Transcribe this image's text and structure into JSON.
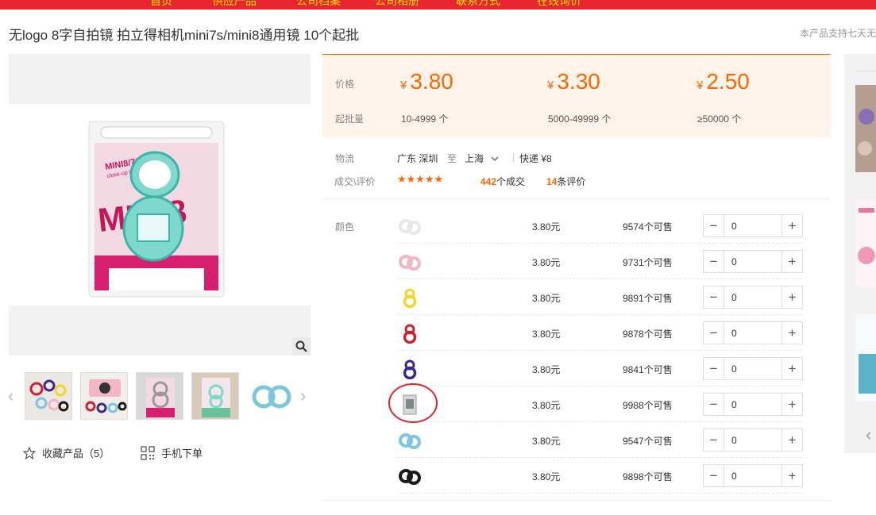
{
  "nav": {
    "items": [
      "首页",
      "供应产品",
      "公司档案",
      "公司相册",
      "联系方式",
      "在线询价"
    ]
  },
  "product": {
    "title": "无logo 8字自拍镜 拍立得相机mini7s/mini8通用镜 10个起批",
    "support_note": "本产品支持七天无"
  },
  "pricing": {
    "price_label": "价格",
    "moq_label": "起批量",
    "currency": "¥",
    "tiers": [
      {
        "price": "3.80",
        "range": "10-4999 个"
      },
      {
        "price": "3.30",
        "range": "5000-49999 个"
      },
      {
        "price": "2.50",
        "range": "≥50000 个"
      }
    ]
  },
  "logistics": {
    "label": "物流",
    "from": "广东 深圳",
    "to_word": "至",
    "to": "上海",
    "shipping": "快递 ¥8"
  },
  "trade": {
    "label": "成交\\评价",
    "stars": "★★★★★",
    "deals_count": "442",
    "deals_suffix": "个成交",
    "reviews_count": "14",
    "reviews_suffix": "条评价"
  },
  "sku": {
    "label": "颜色",
    "rows": [
      {
        "color_name": "white",
        "color": "#e8e8e8",
        "price": "3.80元",
        "stock": "9574个可售",
        "qty": "0"
      },
      {
        "color_name": "pink",
        "color": "#f2b6c4",
        "price": "3.80元",
        "stock": "9731个可售",
        "qty": "0"
      },
      {
        "color_name": "yellow",
        "color": "#f5d52a",
        "price": "3.80元",
        "stock": "9891个可售",
        "qty": "0"
      },
      {
        "color_name": "red",
        "color": "#d0212e",
        "price": "3.80元",
        "stock": "9878个可售",
        "qty": "0"
      },
      {
        "color_name": "purple",
        "color": "#3a2a8c",
        "price": "3.80元",
        "stock": "9841个可售",
        "qty": "0"
      },
      {
        "color_name": "package",
        "color": "#7a8a8a",
        "price": "3.80元",
        "stock": "9988个可售",
        "qty": "0"
      },
      {
        "color_name": "blue",
        "color": "#7cc6e0",
        "price": "3.80元",
        "stock": "9547个可售",
        "qty": "0"
      },
      {
        "color_name": "black",
        "color": "#1a1a1a",
        "price": "3.80元",
        "stock": "9898个可售",
        "qty": "0"
      }
    ]
  },
  "actions": {
    "favorite": "收藏产品（5）",
    "mobile_order": "手机下单"
  },
  "package_text": {
    "brand": "MINI8/7S",
    "sub": "close-up lens",
    "big": "MINI8"
  },
  "colors": {
    "accent": "#ff6600",
    "nav_bg": "#e8242f",
    "nav_text": "#ffe000",
    "price_bg": "#fff3ea",
    "annotation": "#e0242b"
  }
}
